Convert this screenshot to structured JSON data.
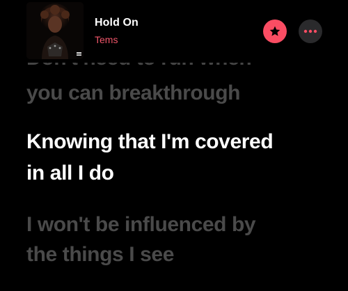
{
  "now_playing": {
    "title": "Hold On",
    "artist": "Tems"
  },
  "actions": {
    "favorite_icon": "star-icon",
    "more_icon": "ellipsis-icon"
  },
  "lyrics": {
    "previous_line_partial": "Don't need to run when",
    "previous_line": "you can breakthrough",
    "current_line_1": "Knowing that I'm covered",
    "current_line_2": "in all I do",
    "next_line_1": "I won't be influenced by",
    "next_line_2": "the things I see"
  },
  "colors": {
    "background": "#000000",
    "accent": "#fa4d63",
    "artist_text": "#f0566a",
    "active_lyric": "#ffffff",
    "dim_lyric": "#4a4a4a",
    "more_button_bg": "#2a2a2c"
  }
}
